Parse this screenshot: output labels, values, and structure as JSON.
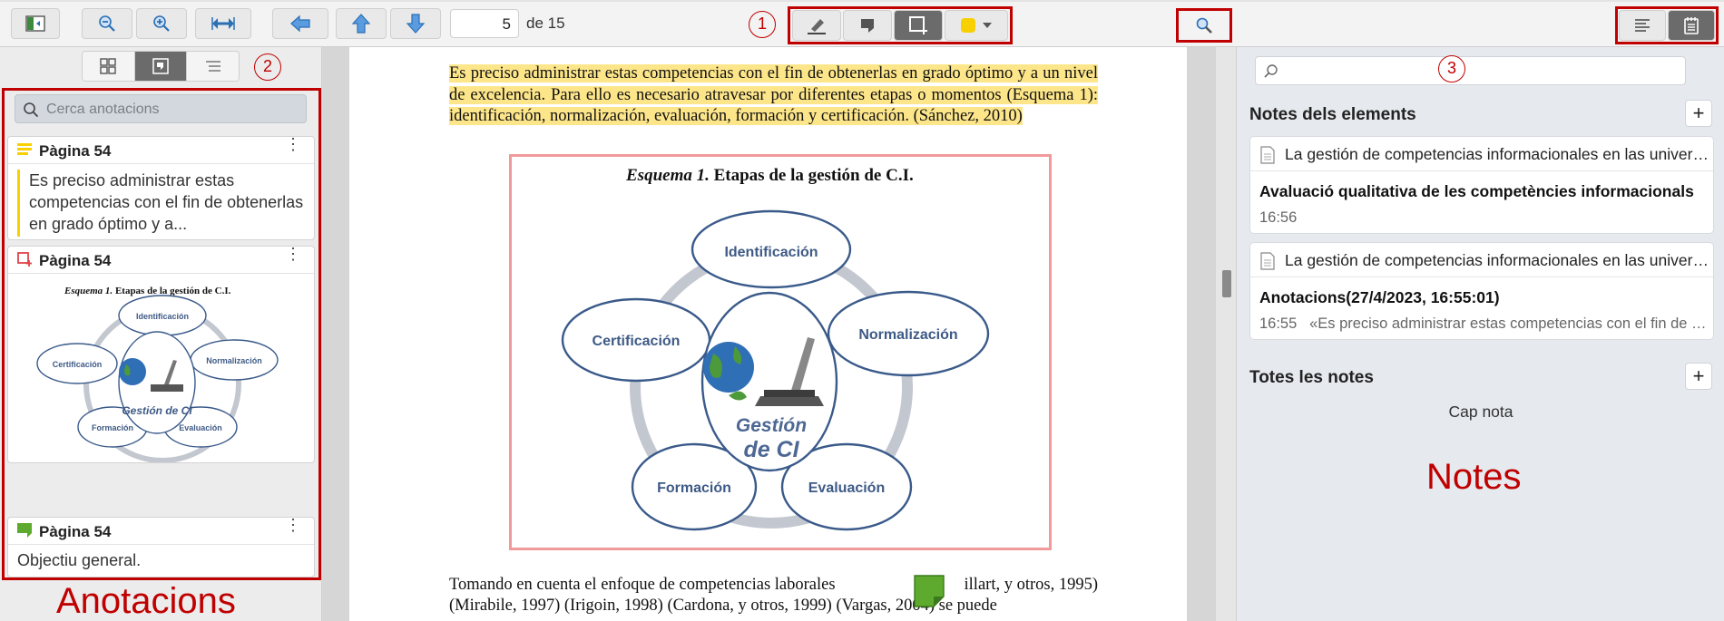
{
  "toolbar": {
    "page_current": "5",
    "page_total_label": "de 15",
    "highlight_color": "#f8d000"
  },
  "callouts": {
    "one": "1",
    "two": "2",
    "three": "3",
    "label_left": "Anotacions",
    "label_right": "Notes"
  },
  "left_pane": {
    "search_placeholder": "Cerca anotacions",
    "annotations": [
      {
        "page": "Pàgina 54",
        "type_icon": "highlight-icon",
        "text": "Es preciso administrar estas competencias con el fin de obtenerlas en grado óptimo y a..."
      },
      {
        "page": "Pàgina 54",
        "type_icon": "image-area-icon",
        "thumbnail_title_italic": "Esquema 1.",
        "thumbnail_title_rest": " Etapas de la gestión de C.I.",
        "thumbnail_center": "Gestión de CI",
        "thumbnail_nodes": [
          "Identificación",
          "Normalización",
          "Evaluación",
          "Formación",
          "Certificación"
        ]
      },
      {
        "page": "Pàgina 54",
        "type_icon": "note-icon",
        "text": "Objectiu general."
      }
    ]
  },
  "document": {
    "para1": "Es preciso administrar estas competencias con el fin de obtenerlas en grado óptimo y a un nivel de excelencia. Para ello es necesario atravesar por diferentes etapas o momentos (Esquema 1): identificación, normalización, evaluación, formación y certificación. (Sánchez, 2010)",
    "figure_title_italic": "Esquema 1.",
    "figure_title_rest": " Etapas de la gestión de C.I.",
    "figure_nodes": {
      "top": "Identificación",
      "right": "Normalización",
      "bottom_right": "Evaluación",
      "bottom_left": "Formación",
      "left": "Certificación"
    },
    "figure_center_1": "Gestión",
    "figure_center_2": "de CI",
    "para2_line1_a": "Tomando en cuenta el enfoque de competencias laborales",
    "para2_line1_b": "illart, y otros, 1995)",
    "para2_line2": "(Mirabile, 1997) (Irigoin, 1998) (Cardona, y otros, 1999) (Vargas, 2004) se puede"
  },
  "right_pane": {
    "search_value": "",
    "item_notes_title": "Notes dels elements",
    "item_notes": [
      {
        "parent": "La gestión de competencias informacionales en las universidades",
        "title": "Avaluació qualitativa de les competències informacionals",
        "time": "16:56",
        "excerpt": ""
      },
      {
        "parent": "La gestión de competencias informacionales en las universidades",
        "title": "Anotacions(27/4/2023, 16:55:01)",
        "time": "16:55",
        "excerpt": "«Es preciso administrar estas competencias con el fin de obtenerlas"
      }
    ],
    "all_notes_title": "Totes les notes",
    "no_notes": "Cap nota"
  },
  "colors": {
    "callout_red": "#c00000",
    "highlight_yellow": "#fde68a",
    "image_annot_border": "#f19a9a",
    "note_green": "#5daa2e",
    "node_stroke": "#3a5a8a",
    "node_text": "#3e5a86"
  }
}
